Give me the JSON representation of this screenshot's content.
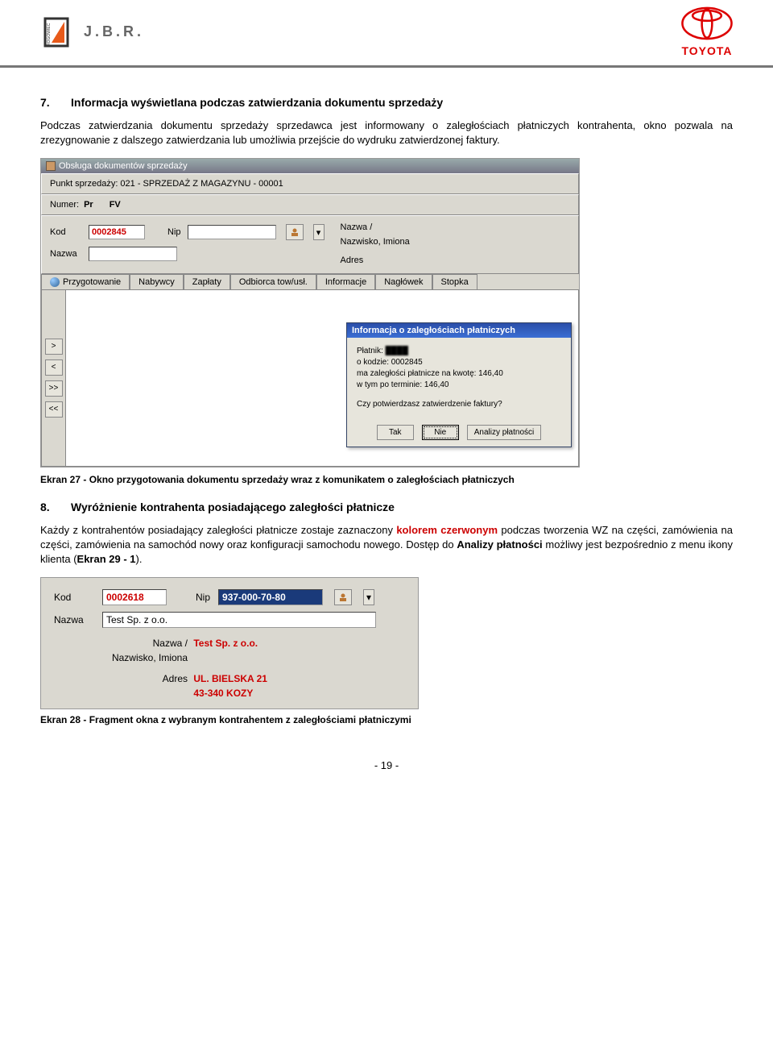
{
  "header": {
    "jbr": "J.B.R.",
    "rogowiec": "ROGOWIEC",
    "toyota": "TOYOTA"
  },
  "section7": {
    "num": "7.",
    "title": "Informacja wyświetlana podczas zatwierdzania dokumentu sprzedaży",
    "para": "Podczas zatwierdzania dokumentu sprzedaży sprzedawca jest informowany o zaległościach płatniczych kontrahenta, okno pozwala na zrezygnowanie z dalszego zatwierdzania lub umożliwia przejście do wydruku zatwierdzonej faktury."
  },
  "screenshot1": {
    "win_title": "Obsługa dokumentów sprzedaży",
    "punkt": "Punkt sprzedaży: 021 - SPRZEDAŻ Z MAGAZYNU - 00001",
    "numer_label": "Numer:",
    "numer_pr": "Pr",
    "numer_fv": "FV",
    "kod_label": "Kod",
    "kod_val": "0002845",
    "nip_label": "Nip",
    "nazwa_label": "Nazwa",
    "nazwa_val": "",
    "r_nazwa_label": "Nazwa /",
    "r_nazwa_val": "",
    "r_nazwisko_label": "Nazwisko, Imiona",
    "r_nazwisko_val": "",
    "r_adres_label": "Adres",
    "r_adres_val1": "",
    "r_adres_val2": "",
    "tabs": [
      "Przygotowanie",
      "Nabywcy",
      "Zapłaty",
      "Odbiorca tow/usł.",
      "Informacje",
      "Nagłówek",
      "Stopka"
    ],
    "nav": [
      ">",
      "<",
      ">>",
      "<<"
    ],
    "dialog": {
      "title": "Informacja o zaległościach płatniczych",
      "l1": "Płatnik:",
      "l2": "o kodzie: 0002845",
      "l3": "ma zaległości płatnicze na kwotę: 146,40",
      "l4": "w tym po terminie: 146,40",
      "q": "Czy potwierdzasz zatwierdzenie faktury?",
      "btns": [
        "Tak",
        "Nie",
        "Analizy płatności"
      ]
    }
  },
  "caption27": "Ekran 27 - Okno przygotowania dokumentu sprzedaży wraz z komunikatem o zaległościach płatniczych",
  "section8": {
    "num": "8.",
    "title": "Wyróżnienie kontrahenta posiadającego zaległości płatnicze",
    "para_pre": "Każdy z kontrahentów posiadający zaległości płatnicze zostaje zaznaczony ",
    "para_red": "kolorem czerwonym",
    "para_post": " podczas tworzenia WZ na części, zamówienia na części, zamówienia na samochód nowy oraz konfiguracji samochodu nowego. Dostęp do ",
    "bold1": "Analizy płatności",
    "para_post2": " możliwy jest bezpośrednio z menu ikony klienta (",
    "bold2": "Ekran 29 - 1",
    "para_post3": ")."
  },
  "screenshot2": {
    "kod_label": "Kod",
    "kod_val": "0002618",
    "nip_label": "Nip",
    "nip_val": "937-000-70-80",
    "nazwa_label": "Nazwa",
    "nazwa_val": "Test Sp. z o.o.",
    "r_nazwa_label": "Nazwa /",
    "r_nazwa_val": "Test Sp. z o.o.",
    "r_nazwisko_label": "Nazwisko, Imiona",
    "r_adres_label": "Adres",
    "r_adres_val1": "UL. BIELSKA 21",
    "r_adres_val2": "43-340 KOZY"
  },
  "caption28": "Ekran 28 - Fragment okna z wybranym kontrahentem z zaległościami płatniczymi",
  "page_number": "- 19 -"
}
